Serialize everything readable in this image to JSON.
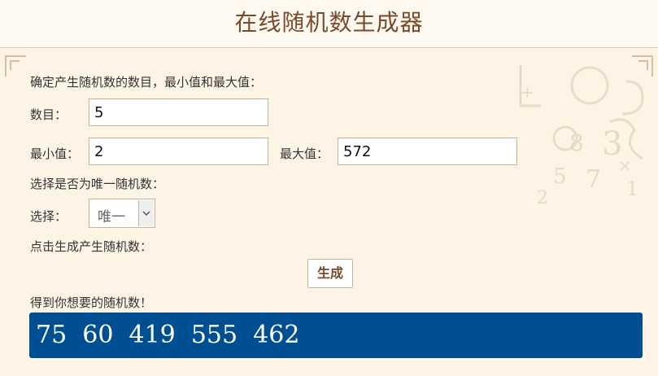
{
  "header": {
    "title": "在线随机数生成器"
  },
  "form": {
    "intro": "确定产生随机数的数目，最小值和最大值：",
    "count_label": "数目：",
    "count_value": "5",
    "min_label": "最小值：",
    "min_value": "2",
    "max_label": "最大值：",
    "max_value": "572",
    "unique_prompt": "选择是否为唯一随机数：",
    "select_label": "选择：",
    "select_value": "唯一",
    "generate_prompt": "点击生成产生随机数：",
    "generate_button": "生成",
    "result_prompt": "得到你想要的随机数！",
    "result_values": "75  60  419  555  462"
  },
  "colors": {
    "page_bg": "#fbf3e6",
    "title": "#7a4a2a",
    "result_bg": "#004f93",
    "result_text": "#ffffff"
  }
}
